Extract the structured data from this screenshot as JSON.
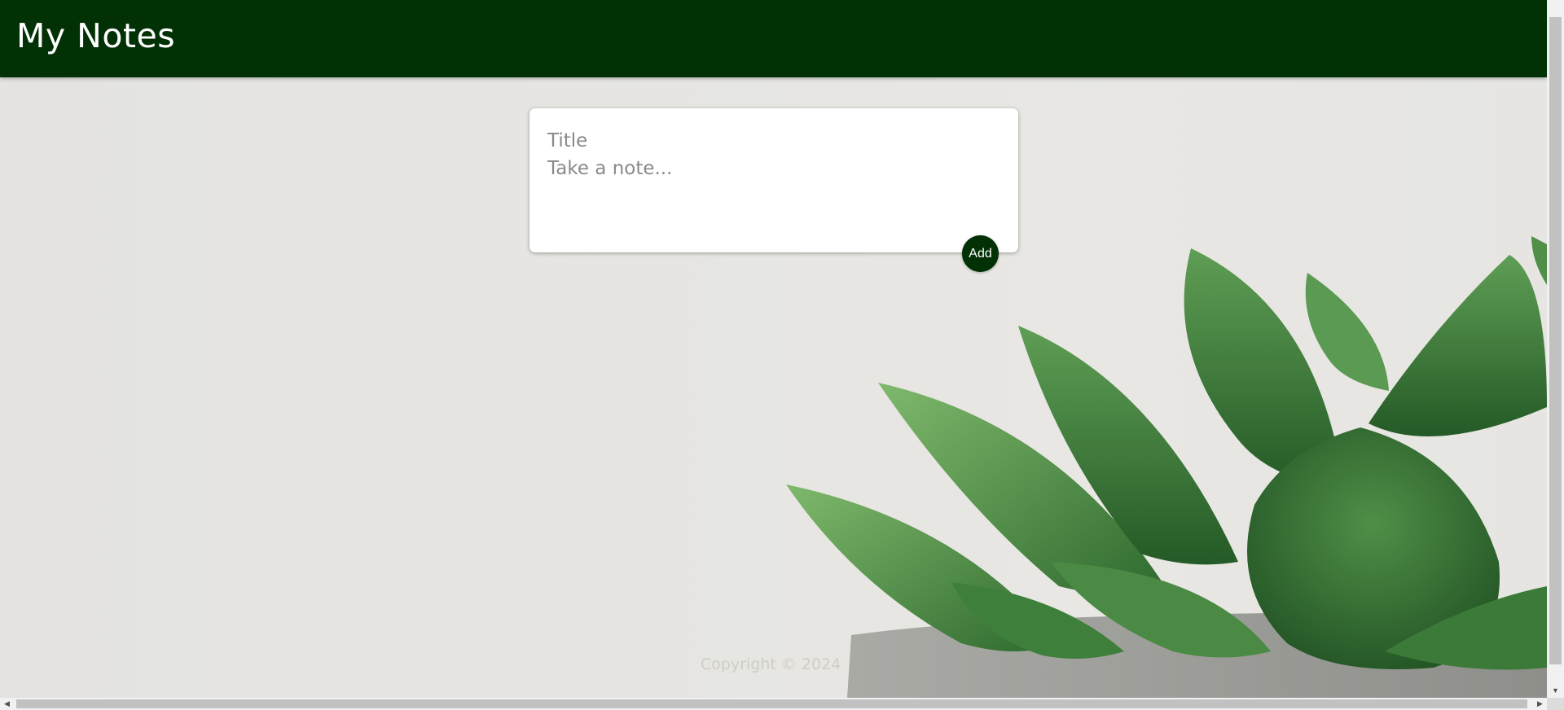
{
  "header": {
    "title": "My Notes"
  },
  "note_form": {
    "title_placeholder": "Title",
    "content_placeholder": "Take a note...",
    "add_label": "Add"
  },
  "footer": {
    "copyright": "Copyright © 2024"
  },
  "scrollbars": {
    "up_arrow": "▲",
    "down_arrow": "▼",
    "left_arrow": "◀",
    "right_arrow": "▶"
  },
  "colors": {
    "brand": "#023105",
    "background": "#e6e5e1",
    "plant_dark": "#2f6a2f",
    "plant_light": "#6fae5f"
  }
}
